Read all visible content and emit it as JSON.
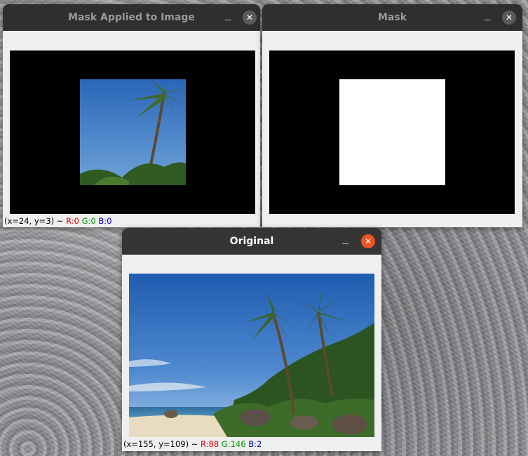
{
  "windows": {
    "masked": {
      "title": "Mask Applied to Image",
      "status": {
        "coords": "(x=24, y=3) ~",
        "r": "R:0",
        "g": "G:0",
        "b": "B:0"
      }
    },
    "mask": {
      "title": "Mask"
    },
    "original": {
      "title": "Original",
      "status": {
        "coords": "(x=155, y=109) ~",
        "r": "R:88",
        "g": "G:146",
        "b": "B:2"
      }
    }
  },
  "icons": {
    "minimize": "minimize-icon",
    "close": "close-icon"
  },
  "colors": {
    "titlebar": "#353535",
    "close_active": "#e95420",
    "close_inactive": "#5a5a5a",
    "red": "#e00000",
    "green": "#009000",
    "blue": "#0000d0"
  }
}
